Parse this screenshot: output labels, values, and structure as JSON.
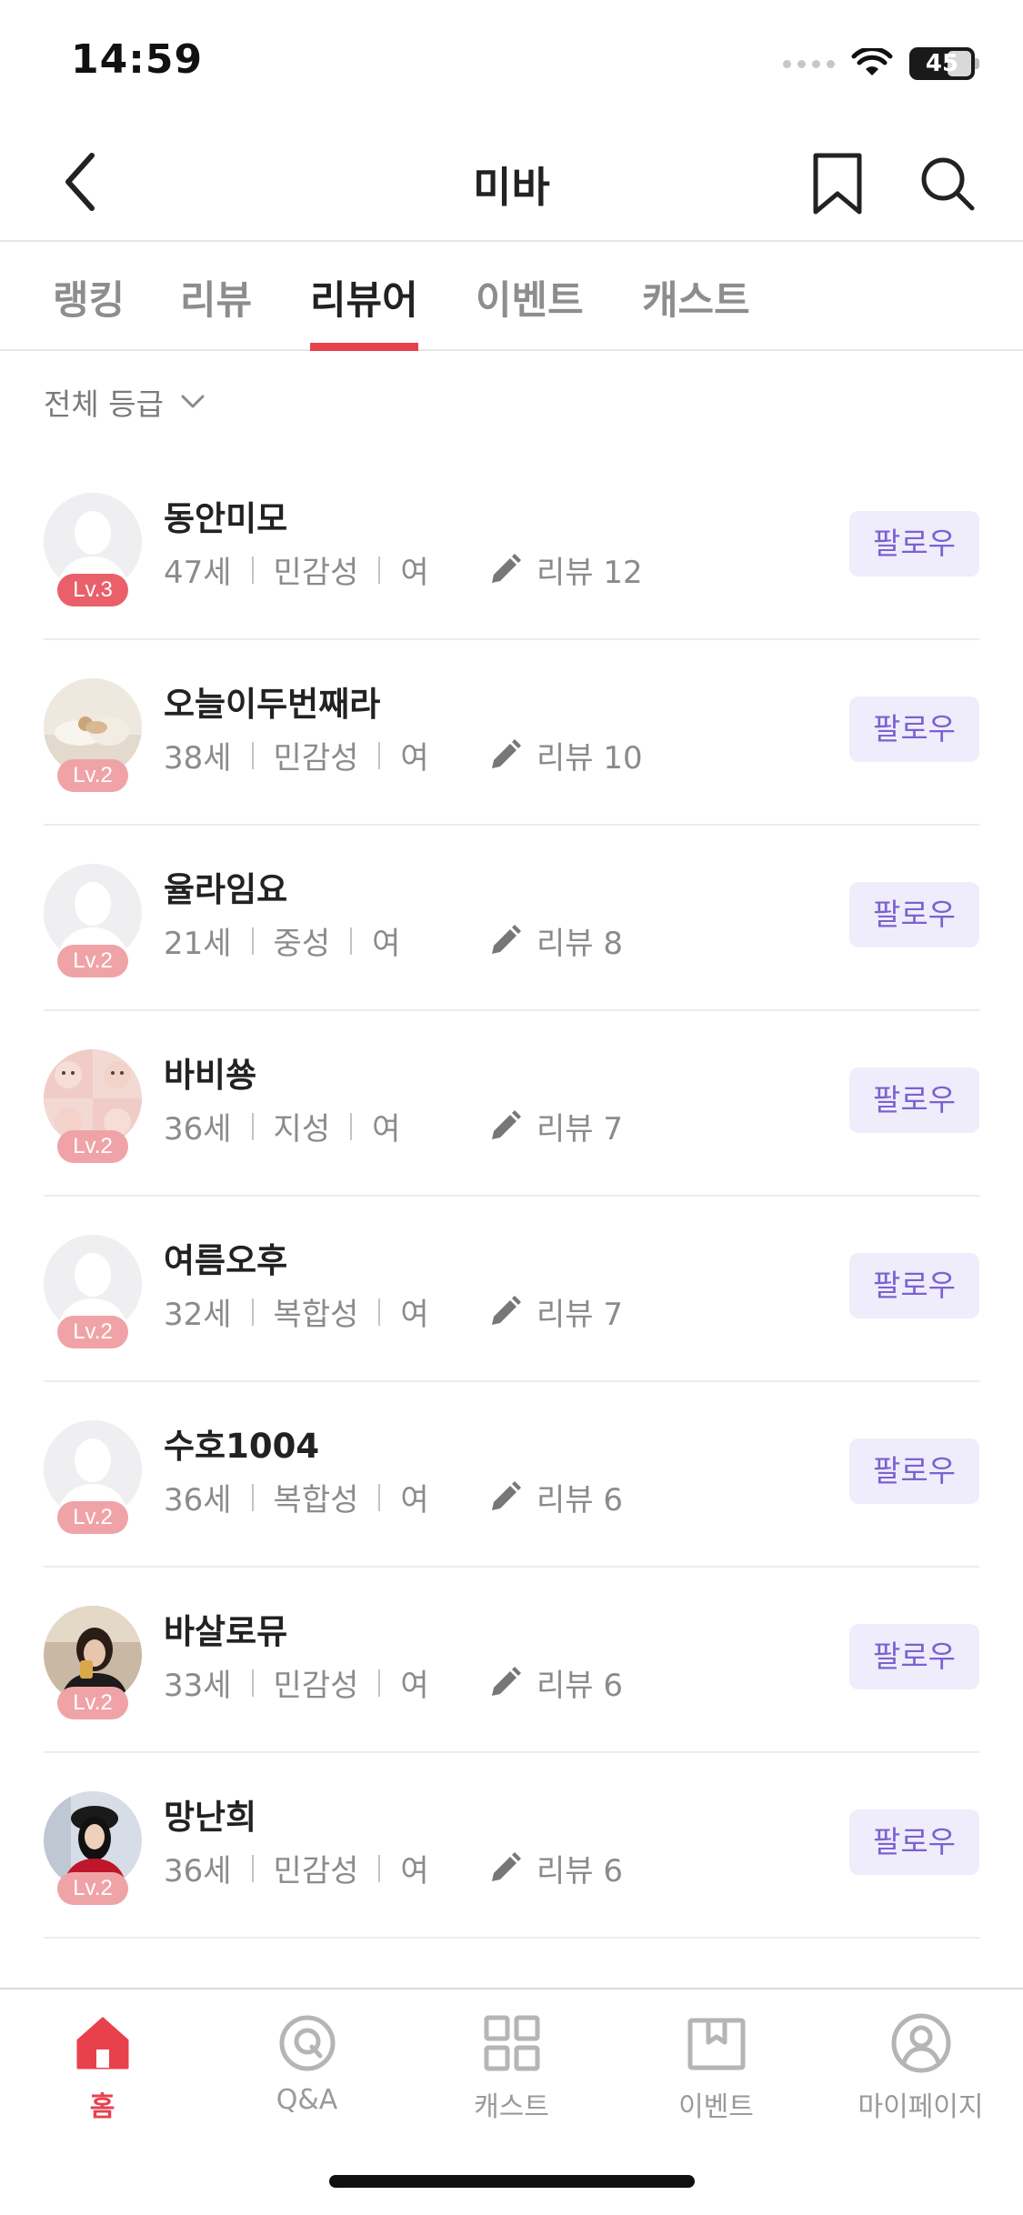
{
  "status_bar": {
    "time": "14:59",
    "battery": "45"
  },
  "header": {
    "title": "미바"
  },
  "tabs": [
    {
      "label": "랭킹"
    },
    {
      "label": "리뷰"
    },
    {
      "label": "리뷰어"
    },
    {
      "label": "이벤트"
    },
    {
      "label": "캐스트"
    }
  ],
  "active_tab": "리뷰어",
  "filter": {
    "label": "전체 등급"
  },
  "follow_label": "팔로우",
  "reviewers": [
    {
      "name": "동안미모",
      "age": "47세",
      "skin": "민감성",
      "gender": "여",
      "reviews": "리뷰 12",
      "level": "Lv.3",
      "avatar": "default"
    },
    {
      "name": "오늘이두번째라",
      "age": "38세",
      "skin": "민감성",
      "gender": "여",
      "reviews": "리뷰 10",
      "level": "Lv.2",
      "avatar": "photo-dog"
    },
    {
      "name": "율라임요",
      "age": "21세",
      "skin": "중성",
      "gender": "여",
      "reviews": "리뷰 8",
      "level": "Lv.2",
      "avatar": "default"
    },
    {
      "name": "바비쑝",
      "age": "36세",
      "skin": "지성",
      "gender": "여",
      "reviews": "리뷰 7",
      "level": "Lv.2",
      "avatar": "photo-faces"
    },
    {
      "name": "여름오후",
      "age": "32세",
      "skin": "복합성",
      "gender": "여",
      "reviews": "리뷰 7",
      "level": "Lv.2",
      "avatar": "default"
    },
    {
      "name": "수호1004",
      "age": "36세",
      "skin": "복합성",
      "gender": "여",
      "reviews": "리뷰 6",
      "level": "Lv.2",
      "avatar": "default"
    },
    {
      "name": "바살로뮤",
      "age": "33세",
      "skin": "민감성",
      "gender": "여",
      "reviews": "리뷰 6",
      "level": "Lv.2",
      "avatar": "photo-woman"
    },
    {
      "name": "망난희",
      "age": "36세",
      "skin": "민감성",
      "gender": "여",
      "reviews": "리뷰 6",
      "level": "Lv.2",
      "avatar": "photo-red"
    }
  ],
  "bottom_nav": [
    {
      "label": "홈",
      "icon": "home-icon",
      "active": true
    },
    {
      "label": "Q&A",
      "icon": "qna-icon",
      "active": false
    },
    {
      "label": "캐스트",
      "icon": "grid-icon",
      "active": false
    },
    {
      "label": "이벤트",
      "icon": "gift-box-icon",
      "active": false
    },
    {
      "label": "마이페이지",
      "icon": "profile-icon",
      "active": false
    }
  ],
  "colors": {
    "accent": "#e8414d",
    "follow_bg": "#efedfb",
    "follow_text": "#7b62d0",
    "level_badge": "#f0a3a7",
    "level3_badge": "#e9606a"
  }
}
